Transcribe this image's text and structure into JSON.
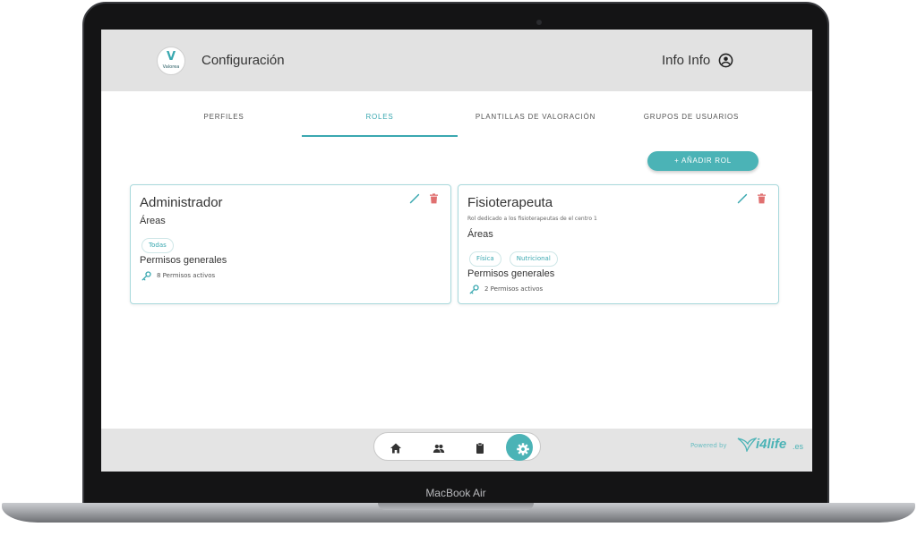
{
  "header": {
    "logo_text": "Valorea",
    "title": "Configuración",
    "user_name": "Info Info"
  },
  "tabs": [
    {
      "label": "PERFILES",
      "active": false
    },
    {
      "label": "ROLES",
      "active": true
    },
    {
      "label": "PLANTILLAS DE VALORACIÓN",
      "active": false
    },
    {
      "label": "GRUPOS DE USUARIOS",
      "active": false
    }
  ],
  "actions": {
    "add_role_label": "+ AÑADIR ROL"
  },
  "roles": [
    {
      "name": "Administrador",
      "description": "",
      "areas_label": "Áreas",
      "areas": [
        "Todas"
      ],
      "permissions_label": "Permisos generales",
      "permissions_text": "8 Permisos activos"
    },
    {
      "name": "Fisioterapeuta",
      "description": "Rol dedicado a los fisioterapeutas de el centro 1",
      "areas_label": "Áreas",
      "areas": [
        "Física",
        "Nutricional"
      ],
      "permissions_label": "Permisos generales",
      "permissions_text": "2 Permisos activos"
    }
  ],
  "bottom_nav": {
    "items": [
      {
        "icon": "home-icon",
        "active": false
      },
      {
        "icon": "users-icon",
        "active": false
      },
      {
        "icon": "clipboard-icon",
        "active": false
      },
      {
        "icon": "settings-icon",
        "active": true
      }
    ]
  },
  "footer": {
    "powered_by": "Powered by",
    "brand": "i4life",
    "brand_tld": ".es"
  },
  "device": {
    "label": "MacBook Air"
  },
  "colors": {
    "accent": "#4bb3b6",
    "header_bg": "#e2e2e2",
    "card_border": "#a8d9dc",
    "delete": "#e07070"
  }
}
